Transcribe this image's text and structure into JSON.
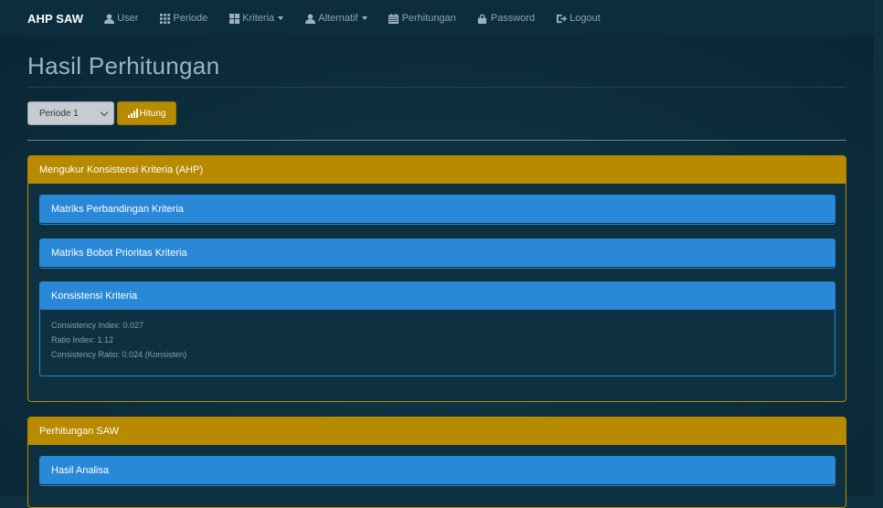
{
  "navbar": {
    "brand": "AHP SAW",
    "items": [
      {
        "label": "User",
        "icon": "user-icon",
        "dropdown": false
      },
      {
        "label": "Periode",
        "icon": "grid-icon",
        "dropdown": false
      },
      {
        "label": "Kriteria",
        "icon": "table-icon",
        "dropdown": true
      },
      {
        "label": "Alternatif",
        "icon": "user-icon",
        "dropdown": true
      },
      {
        "label": "Perhitungan",
        "icon": "calendar-icon",
        "dropdown": false
      },
      {
        "label": "Password",
        "icon": "lock-icon",
        "dropdown": false
      },
      {
        "label": "Logout",
        "icon": "logout-icon",
        "dropdown": false
      }
    ]
  },
  "page": {
    "title": "Hasil Perhitungan",
    "periode_select": {
      "value": "Periode 1"
    },
    "hitung_button": {
      "label": "Hitung",
      "icon": "signal-icon"
    }
  },
  "panels": {
    "ahp": {
      "title": "Mengukur Konsistensi Kriteria (AHP)",
      "matriks_perbandingan": "Matriks Perbandingan Kriteria",
      "matriks_bobot": "Matriks Bobot Prioritas Kriteria",
      "konsistensi": {
        "title": "Konsistensi Kriteria",
        "ci": "Consistency Index: 0.027",
        "ri": "Ratio Index: 1.12",
        "cr": "Consistency Ratio: 0.024 (Konsisten)"
      }
    },
    "saw": {
      "title": "Perhitungan SAW",
      "hasil_analisa": "Hasil Analisa"
    }
  },
  "colors": {
    "navbar": "#0c2d3d",
    "background": "#0f3040",
    "warning": "#b78a00",
    "primary": "#2a88d8"
  }
}
